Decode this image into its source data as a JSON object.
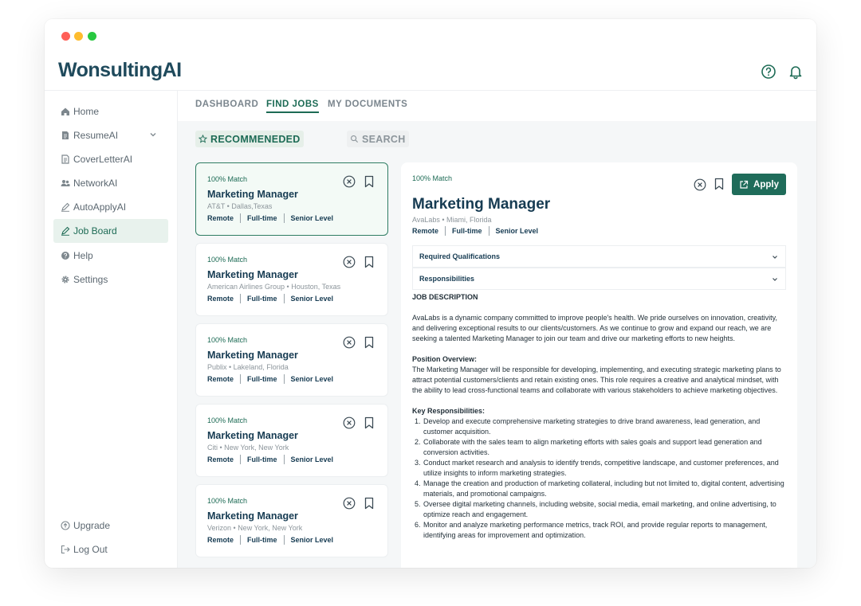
{
  "app": {
    "logo": "WonsultingAI",
    "window_dots": [
      "#ff5f57",
      "#febc2e",
      "#28c840"
    ],
    "brand_color": "#1d6b55"
  },
  "header": {
    "help_icon": "help-circle-icon",
    "notification_icon": "bell-icon"
  },
  "sidebar": {
    "items": [
      {
        "label": "Home",
        "icon": "home-icon"
      },
      {
        "label": "ResumeAI",
        "icon": "document-icon"
      },
      {
        "label": "CoverLetterAI",
        "icon": "letter-icon"
      },
      {
        "label": "NetworkAI",
        "icon": "people-icon"
      },
      {
        "label": "AutoApplyAI",
        "icon": "pen-icon"
      },
      {
        "label": "Job Board",
        "icon": "pen-icon",
        "active": true
      },
      {
        "label": "Help",
        "icon": "help-icon"
      },
      {
        "label": "Settings",
        "icon": "gear-icon"
      }
    ],
    "bottom": [
      {
        "label": "Upgrade",
        "icon": "arrow-up-circle-icon"
      },
      {
        "label": "Log Out",
        "icon": "logout-icon"
      }
    ]
  },
  "tabs": [
    "DASHBOARD",
    "FIND JOBS",
    "MY DOCUMENTS"
  ],
  "active_tab": "FIND JOBS",
  "subtabs": {
    "recommended": "RECOMMENEDED",
    "search": "SEARCH"
  },
  "jobs": [
    {
      "match": "100% Match",
      "title": "Marketing Manager",
      "company": "AT&T",
      "location": "Dallas,Texas",
      "tags": [
        "Remote",
        "Full-time",
        "Senior Level"
      ]
    },
    {
      "match": "100% Match",
      "title": "Marketing Manager",
      "company": "American Airlines Group",
      "location": "Houston, Texas",
      "tags": [
        "Remote",
        "Full-time",
        "Senior Level"
      ]
    },
    {
      "match": "100% Match",
      "title": "Marketing Manager",
      "company": "Publix",
      "location": "Lakeland, Florida",
      "tags": [
        "Remote",
        "Full-time",
        "Senior Level"
      ]
    },
    {
      "match": "100% Match",
      "title": "Marketing Manager",
      "company": "Citi",
      "location": "New York, New York",
      "tags": [
        "Remote",
        "Full-time",
        "Senior Level"
      ]
    },
    {
      "match": "100% Match",
      "title": "Marketing Manager",
      "company": "Verizon",
      "location": "New York, New York",
      "tags": [
        "Remote",
        "Full-time",
        "Senior Level"
      ]
    }
  ],
  "detail": {
    "match": "100% Match",
    "title": "Marketing Manager",
    "company": "AvaLabs",
    "location": "Miami, Florida",
    "tags": [
      "Remote",
      "Full-time",
      "Senior Level"
    ],
    "apply_label": "Apply",
    "accordions": [
      "Required Qualifications",
      "Responsibilities"
    ],
    "description_heading": "JOB DESCRIPTION",
    "intro": "AvaLabs is a dynamic company committed to improve people's health. We pride ourselves on innovation, creativity, and delivering exceptional results to our clients/customers. As we continue to grow and expand our reach, we are seeking a talented Marketing Manager to join our team and drive our marketing efforts to new heights.",
    "overview_heading": "Position Overview:",
    "overview": "The Marketing Manager will be responsible for developing, implementing, and executing strategic marketing plans to attract potential customers/clients and retain existing ones. This role requires a creative and analytical mindset, with the ability to lead cross-functional teams and collaborate with various stakeholders to achieve marketing objectives.",
    "responsibilities_heading": "Key Responsibilities:",
    "responsibilities": [
      "Develop and execute comprehensive marketing strategies to drive brand awareness, lead generation, and customer acquisition.",
      "Collaborate with the sales team to align marketing efforts with sales goals and support lead generation and conversion activities.",
      "Conduct market research and analysis to identify trends, competitive landscape, and customer preferences, and utilize insights to inform marketing strategies.",
      "Manage the creation and production of marketing collateral, including but not limited to, digital content, advertising materials, and promotional campaigns.",
      "Oversee digital marketing channels, including website, social media, email marketing, and online advertising, to optimize reach and engagement.",
      "Monitor and analyze marketing performance metrics, track ROI, and provide regular reports to management, identifying areas for improvement and optimization."
    ]
  }
}
